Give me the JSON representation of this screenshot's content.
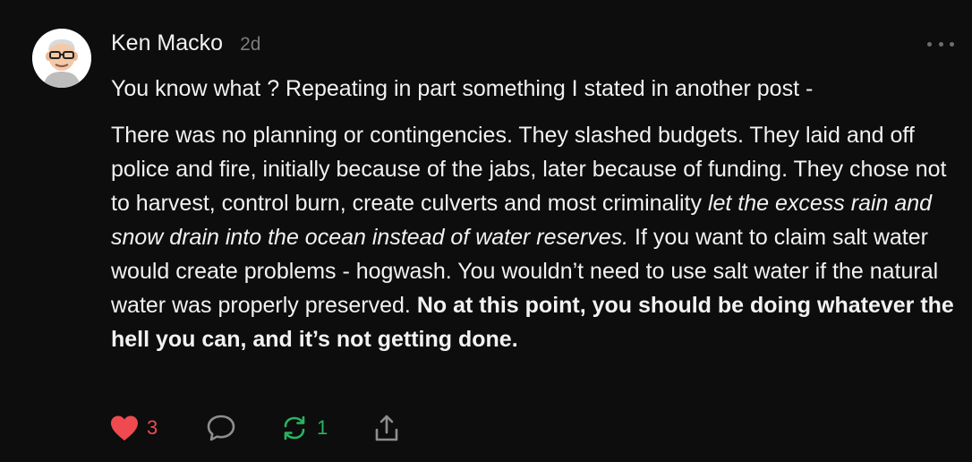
{
  "comment": {
    "author": "Ken Macko",
    "timestamp": "2d",
    "avatar_icon": "cartoon-avatar-icon",
    "more_icon": "more-options-icon",
    "paragraph1": "You know what ? Repeating in part something I stated in another post -",
    "paragraph2": {
      "part1": "There was no planning or contingencies. They slashed budgets. They laid and off police and fire, initially because of the jabs, later because of funding. They chose not to harvest, control burn, create culverts and most criminality ",
      "italic": "let the excess rain and snow drain into the ocean instead of water reserves.",
      "part2": " If you want to claim salt water would create problems - hogwash. You wouldn’t need to use salt water if the natural water was properly preserved. ",
      "bold": "No at this point, you should be doing whatever the hell you can, and it’s not getting done."
    }
  },
  "actions": {
    "like": {
      "icon": "heart-icon",
      "count": "3",
      "color": "#ef4a4f"
    },
    "reply": {
      "icon": "speech-bubble-icon"
    },
    "restack": {
      "icon": "restack-icon",
      "count": "1",
      "color": "#2bb363"
    },
    "share": {
      "icon": "share-icon"
    }
  }
}
